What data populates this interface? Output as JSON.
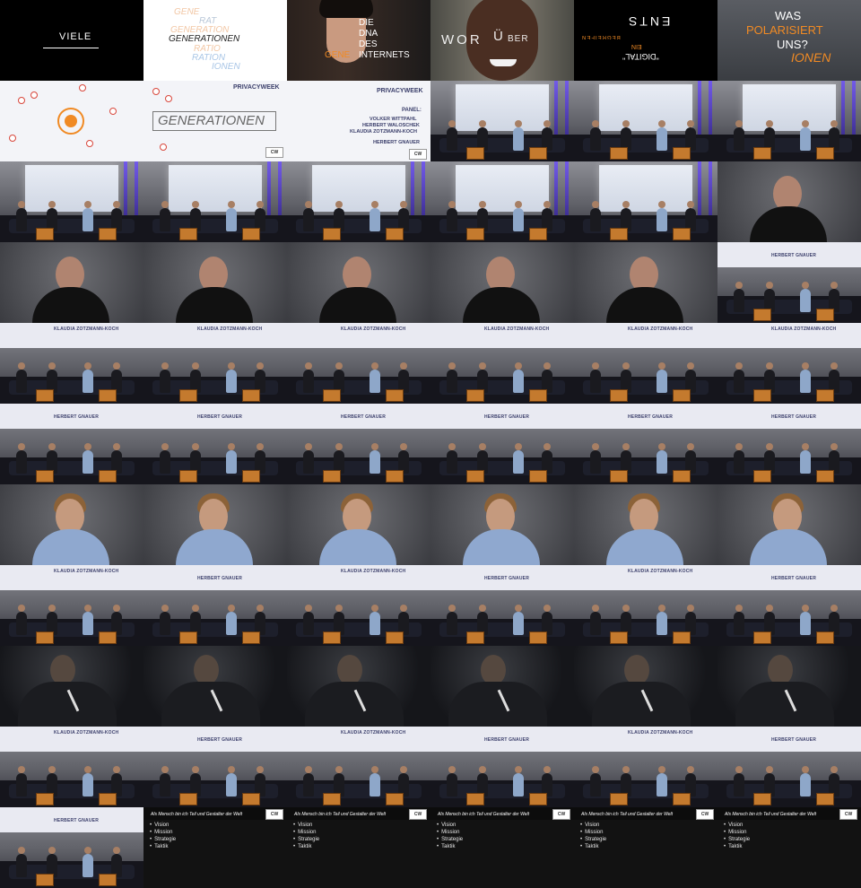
{
  "intro": {
    "viele": "VIELE",
    "gene_words": [
      "GENE",
      "RAT",
      "GENERATION",
      "GENERATIONEN",
      "RATIO",
      "RATION",
      "IONEN"
    ],
    "dna_words": [
      "DIE",
      "DNA",
      "DES",
      "GENE",
      "INTERNETS"
    ],
    "worueber": [
      "WOR",
      "Ü",
      "BER"
    ],
    "mirrored_top": "ENTS",
    "mirrored_mid": "BEGREIFEN",
    "mirrored_ein": "EIN",
    "digital": "\"DIGITAL\"",
    "polar": [
      "WAS",
      "POLARISIERT",
      "UNS?",
      "IONEN"
    ]
  },
  "title_slides": {
    "brand": "PRIVACYWEEK",
    "generationen": "GENERATIONEN",
    "panel_label": "PANEL:",
    "panelists": [
      "VOLKER WITTPAHL",
      "HERBERT WALOSCHEK",
      "KLAUDIA ZOTZMANN-KOCH"
    ],
    "moderator": "HERBERT GNAUER"
  },
  "lower_thirds": {
    "klaudia": "KLAUDIA ZOTZMANN-KOCH",
    "herbert": "HERBERT GNAUER"
  },
  "final_slide": {
    "heading": "Als Mensch bin ich Teil und Gestalter der Welt",
    "items": [
      "Vision",
      "Mission",
      "Strategie",
      "Taktik"
    ],
    "logo": "CW"
  },
  "colors": {
    "orange": "#f08a24",
    "peach": "#f2c7a5",
    "blue_pale": "#a9c6e6",
    "slide_text": "#3b3f6b"
  }
}
